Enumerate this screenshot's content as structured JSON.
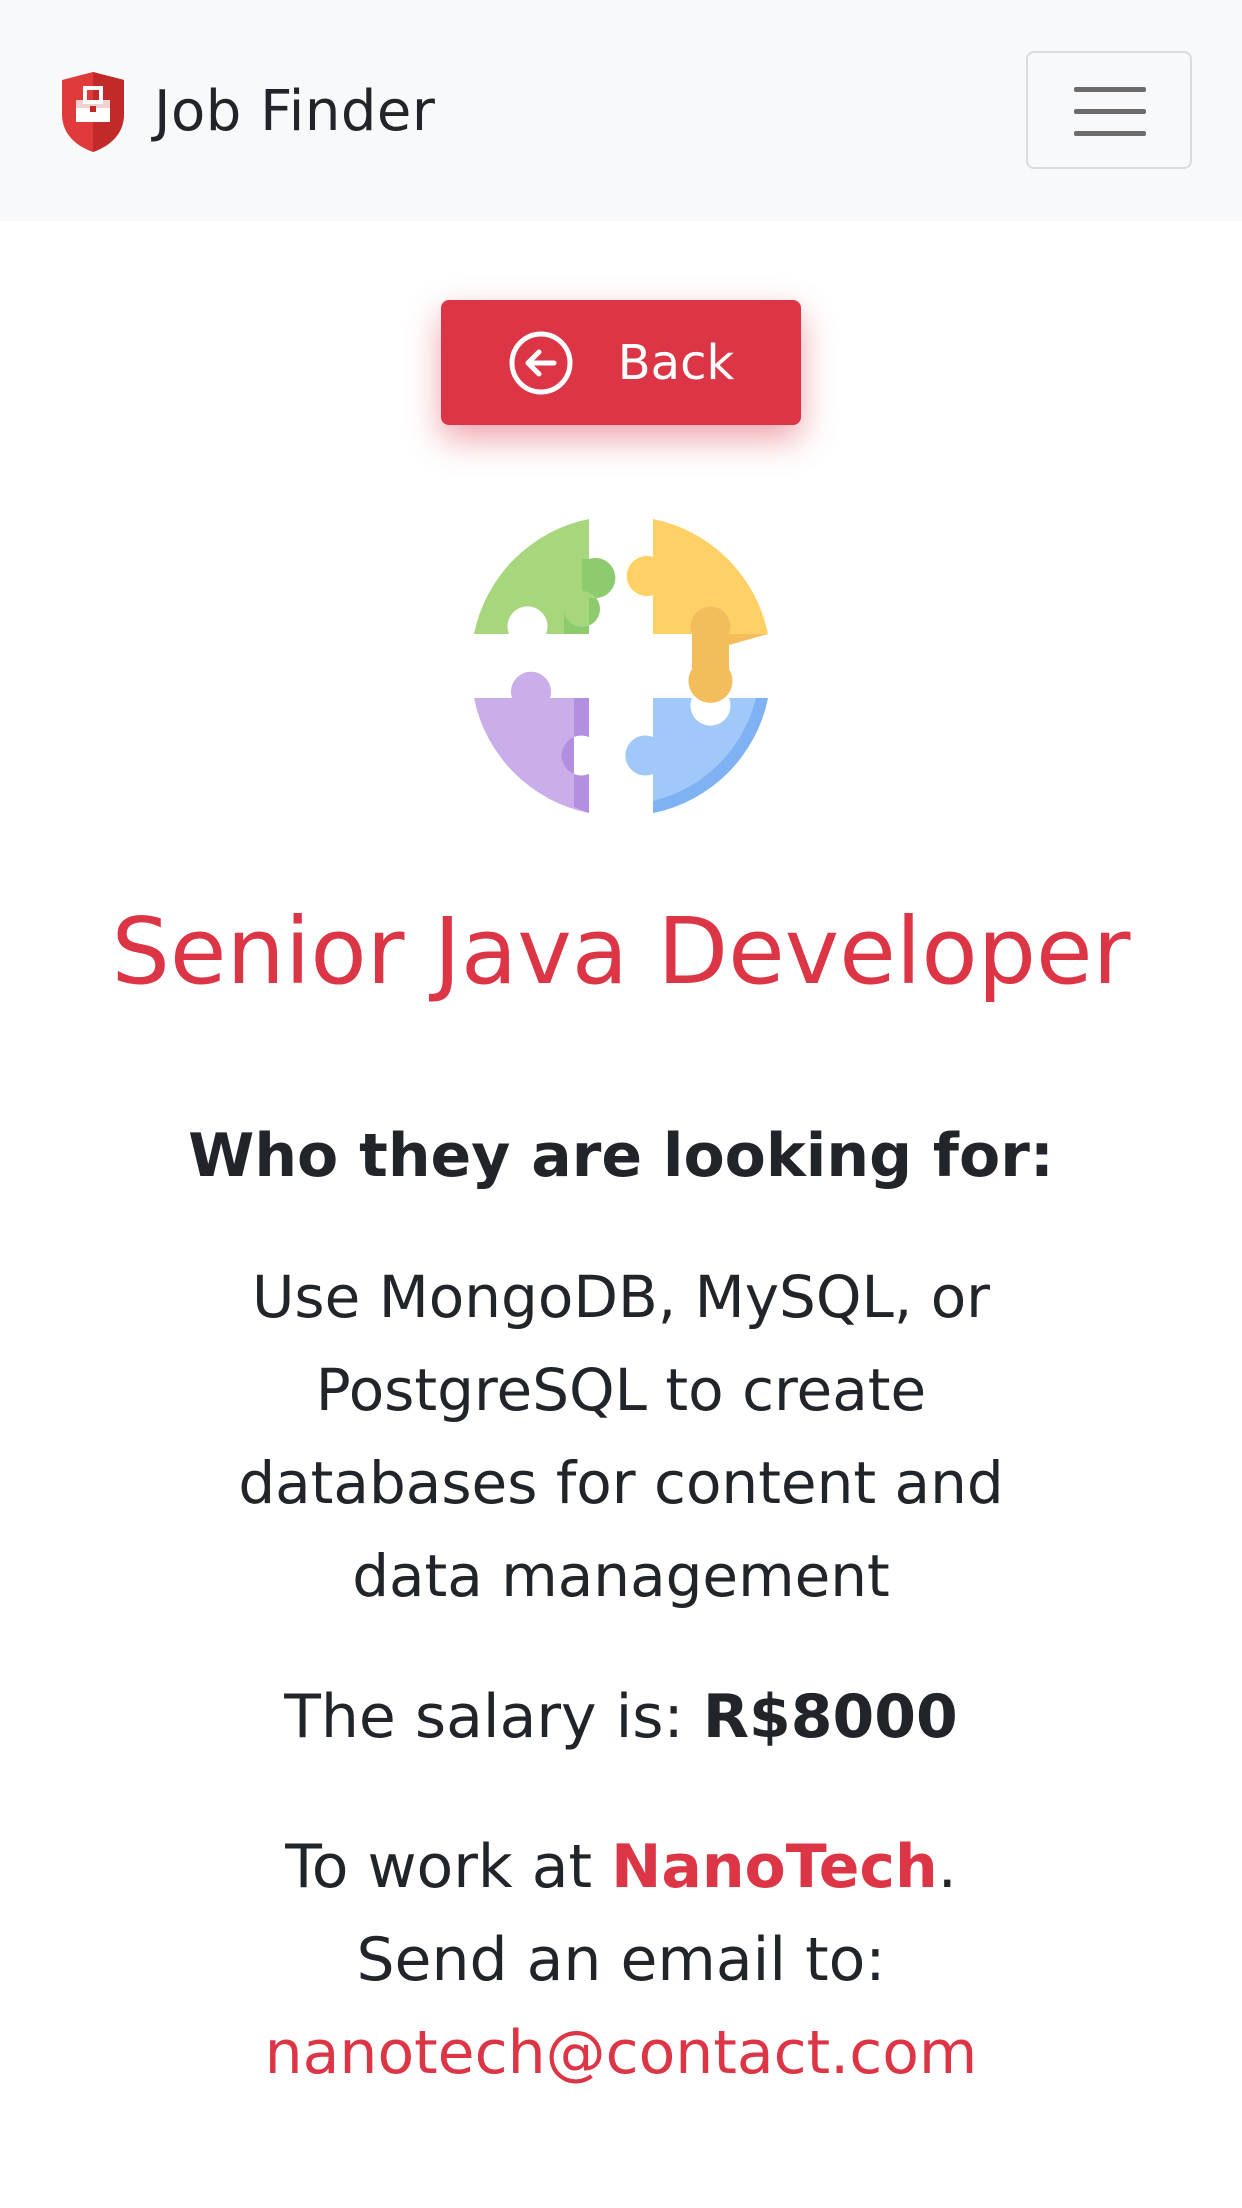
{
  "navbar": {
    "brand_name": "Job Finder",
    "brand_icon": "briefcase-shield-icon",
    "menu_icon": "hamburger-menu-icon"
  },
  "job": {
    "back_label": "Back",
    "back_icon": "arrow-left-circle-icon",
    "illustration": "puzzle-pieces-icon",
    "title": "Senior Java Developer",
    "looking_for_heading": "Who they are looking for:",
    "description": "Use MongoDB, MySQL, or PostgreSQL to create databases for content and data management",
    "salary_prefix": "The salary is: ",
    "salary_value": "R$8000",
    "work_at_prefix": "To work at ",
    "company": "NanoTech",
    "work_at_suffix": ".",
    "email_prompt": "Send an email to:",
    "email": "nanotech@contact.com"
  },
  "colors": {
    "accent": "#dc3545",
    "navbar_bg": "#f8f9fa",
    "text": "#212529",
    "puzzle_green": "#a8d67c",
    "puzzle_yellow": "#ffd066",
    "puzzle_purple": "#c9aee9",
    "puzzle_blue": "#a0c8f8"
  }
}
